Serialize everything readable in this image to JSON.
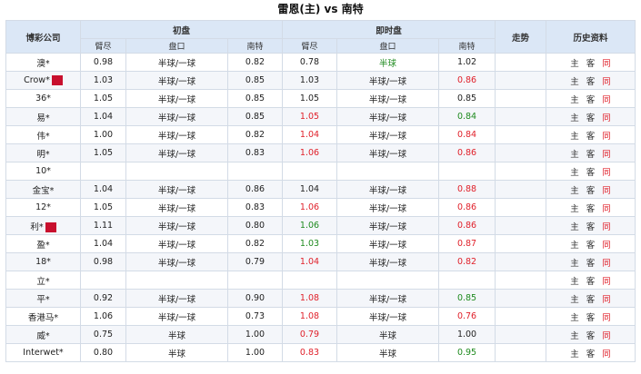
{
  "header": {
    "title": "雷恩(主) vs 南特"
  },
  "columns": {
    "company": "博彩公司",
    "initial": "初盘",
    "live": "即时盘",
    "trend": "走势",
    "history": "历史资料",
    "home": "臂尽",
    "line": "盘口",
    "away": "南特"
  },
  "history_links": {
    "home": "主",
    "away": "客",
    "h2h": "同"
  },
  "rows": [
    {
      "company": "澳*",
      "tag": "",
      "i_home": "0.98",
      "i_line": "半球/一球",
      "i_away": "0.82",
      "l_home": "0.78",
      "l_home_c": "",
      "l_line": "半球",
      "l_line_c": "green",
      "l_away": "1.02",
      "l_away_c": ""
    },
    {
      "company": "Crow*",
      "tag": "冠",
      "i_home": "1.03",
      "i_line": "半球/一球",
      "i_away": "0.85",
      "l_home": "1.03",
      "l_home_c": "",
      "l_line": "半球/一球",
      "l_line_c": "",
      "l_away": "0.86",
      "l_away_c": "red"
    },
    {
      "company": "36*",
      "tag": "",
      "i_home": "1.05",
      "i_line": "半球/一球",
      "i_away": "0.85",
      "l_home": "1.05",
      "l_home_c": "",
      "l_line": "半球/一球",
      "l_line_c": "",
      "l_away": "0.85",
      "l_away_c": ""
    },
    {
      "company": "易*",
      "tag": "",
      "i_home": "1.04",
      "i_line": "半球/一球",
      "i_away": "0.85",
      "l_home": "1.05",
      "l_home_c": "red",
      "l_line": "半球/一球",
      "l_line_c": "",
      "l_away": "0.84",
      "l_away_c": "green"
    },
    {
      "company": "伟*",
      "tag": "",
      "i_home": "1.00",
      "i_line": "半球/一球",
      "i_away": "0.82",
      "l_home": "1.04",
      "l_home_c": "red",
      "l_line": "半球/一球",
      "l_line_c": "",
      "l_away": "0.84",
      "l_away_c": "red"
    },
    {
      "company": "明*",
      "tag": "",
      "i_home": "1.05",
      "i_line": "半球/一球",
      "i_away": "0.83",
      "l_home": "1.06",
      "l_home_c": "red",
      "l_line": "半球/一球",
      "l_line_c": "",
      "l_away": "0.86",
      "l_away_c": "red"
    },
    {
      "company": "10*",
      "tag": "",
      "i_home": "",
      "i_line": "",
      "i_away": "",
      "l_home": "",
      "l_home_c": "",
      "l_line": "",
      "l_line_c": "",
      "l_away": "",
      "l_away_c": ""
    },
    {
      "company": "金宝*",
      "tag": "",
      "i_home": "1.04",
      "i_line": "半球/一球",
      "i_away": "0.86",
      "l_home": "1.04",
      "l_home_c": "",
      "l_line": "半球/一球",
      "l_line_c": "",
      "l_away": "0.88",
      "l_away_c": "red"
    },
    {
      "company": "12*",
      "tag": "",
      "i_home": "1.05",
      "i_line": "半球/一球",
      "i_away": "0.83",
      "l_home": "1.06",
      "l_home_c": "red",
      "l_line": "半球/一球",
      "l_line_c": "",
      "l_away": "0.86",
      "l_away_c": "red"
    },
    {
      "company": "利*",
      "tag": "冠",
      "i_home": "1.11",
      "i_line": "半球/一球",
      "i_away": "0.80",
      "l_home": "1.06",
      "l_home_c": "green",
      "l_line": "半球/一球",
      "l_line_c": "",
      "l_away": "0.86",
      "l_away_c": "red"
    },
    {
      "company": "盈*",
      "tag": "",
      "i_home": "1.04",
      "i_line": "半球/一球",
      "i_away": "0.82",
      "l_home": "1.03",
      "l_home_c": "green",
      "l_line": "半球/一球",
      "l_line_c": "",
      "l_away": "0.87",
      "l_away_c": "red"
    },
    {
      "company": "18*",
      "tag": "",
      "i_home": "0.98",
      "i_line": "半球/一球",
      "i_away": "0.79",
      "l_home": "1.04",
      "l_home_c": "red",
      "l_line": "半球/一球",
      "l_line_c": "",
      "l_away": "0.82",
      "l_away_c": "red"
    },
    {
      "company": "立*",
      "tag": "",
      "i_home": "",
      "i_line": "",
      "i_away": "",
      "l_home": "",
      "l_home_c": "",
      "l_line": "",
      "l_line_c": "",
      "l_away": "",
      "l_away_c": ""
    },
    {
      "company": "平*",
      "tag": "",
      "i_home": "0.92",
      "i_line": "半球/一球",
      "i_away": "0.90",
      "l_home": "1.08",
      "l_home_c": "red",
      "l_line": "半球/一球",
      "l_line_c": "",
      "l_away": "0.85",
      "l_away_c": "green"
    },
    {
      "company": "香港马*",
      "tag": "",
      "i_home": "1.06",
      "i_line": "半球/一球",
      "i_away": "0.73",
      "l_home": "1.08",
      "l_home_c": "red",
      "l_line": "半球/一球",
      "l_line_c": "",
      "l_away": "0.76",
      "l_away_c": "red"
    },
    {
      "company": "威*",
      "tag": "",
      "i_home": "0.75",
      "i_line": "半球",
      "i_away": "1.00",
      "l_home": "0.79",
      "l_home_c": "red",
      "l_line": "半球",
      "l_line_c": "",
      "l_away": "1.00",
      "l_away_c": ""
    },
    {
      "company": "Interwet*",
      "tag": "",
      "i_home": "0.80",
      "i_line": "半球",
      "i_away": "1.00",
      "l_home": "0.83",
      "l_home_c": "red",
      "l_line": "半球",
      "l_line_c": "",
      "l_away": "0.95",
      "l_away_c": "green"
    }
  ]
}
